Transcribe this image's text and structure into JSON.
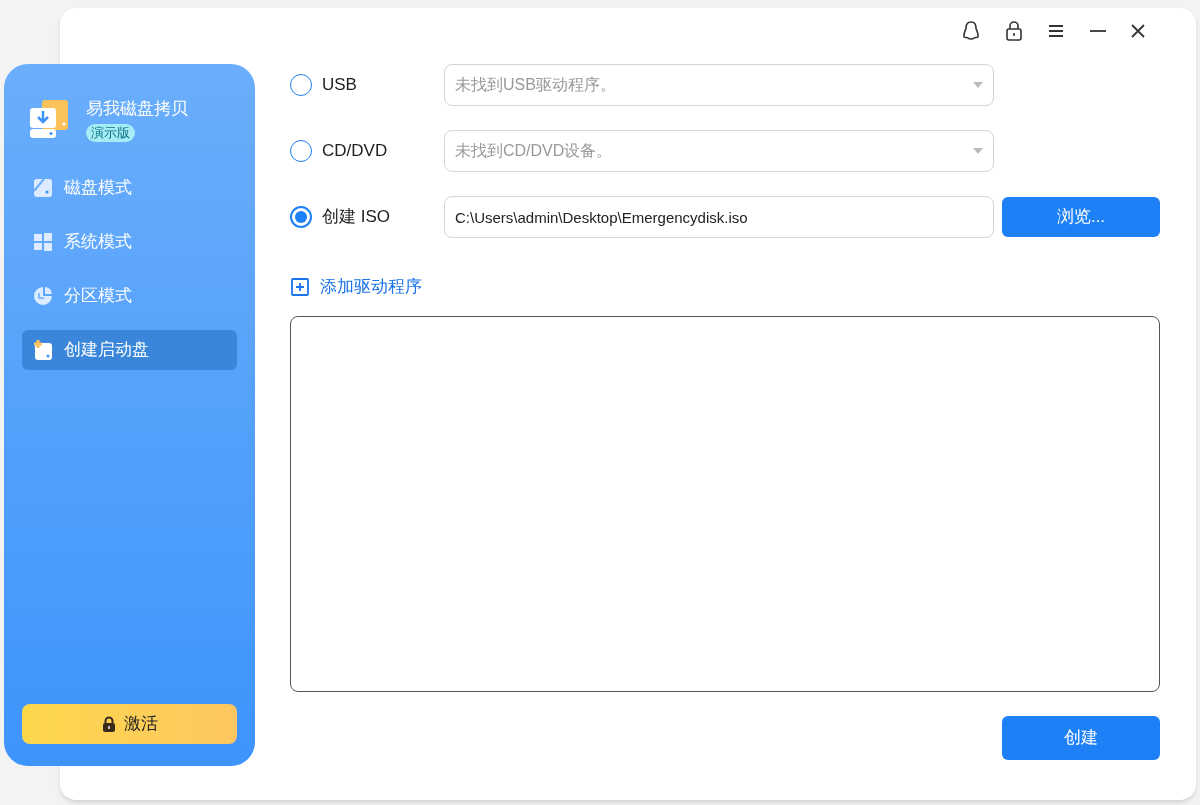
{
  "app": {
    "name": "易我磁盘拷贝",
    "edition": "演示版"
  },
  "sidebar": {
    "items": [
      {
        "label": "磁盘模式",
        "selected": false
      },
      {
        "label": "系统模式",
        "selected": false
      },
      {
        "label": "分区模式",
        "selected": false
      },
      {
        "label": "创建启动盘",
        "selected": true
      }
    ],
    "activate_button": "激活"
  },
  "targets": [
    {
      "label": "USB",
      "selected": false,
      "kind": "dropdown",
      "placeholder": "未找到USB驱动程序。"
    },
    {
      "label": "CD/DVD",
      "selected": false,
      "kind": "dropdown",
      "placeholder": "未找到CD/DVD设备。"
    },
    {
      "label": "创建 ISO",
      "selected": true,
      "kind": "path",
      "value": "C:\\Users\\admin\\Desktop\\Emergencydisk.iso",
      "button": "浏览..."
    }
  ],
  "add_driver_link": "添加驱动程序",
  "create_button": "创建"
}
